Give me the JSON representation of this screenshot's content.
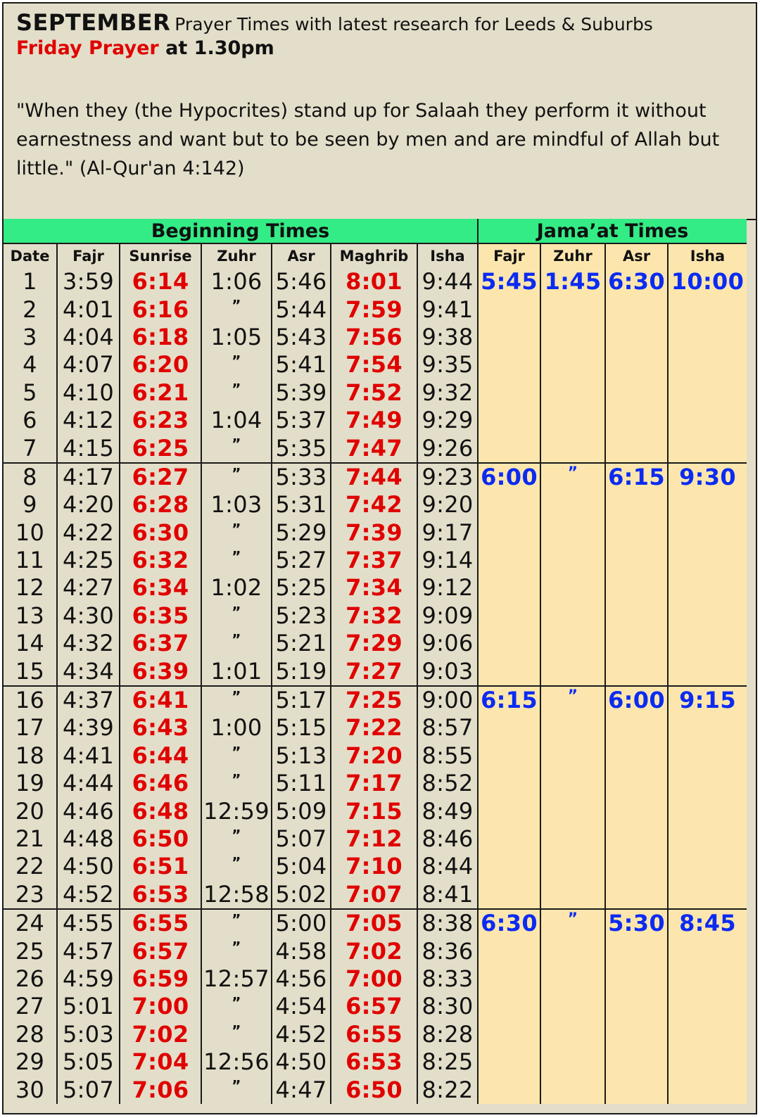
{
  "header": {
    "month": "SEPTEMBER",
    "subtitle": "Prayer Times with latest research for Leeds & Suburbs",
    "friday_label": "Friday Prayer",
    "friday_time": "at 1.30pm",
    "quote": "\"When they (the Hypocrites) stand up for Salaah they perform it without earnestness and want but to be seen by men and are mindful of Allah but little.\" (Al-Qur'an 4:142)"
  },
  "table": {
    "group_beginning": "Beginning Times",
    "group_jamaat": "Jama’at Times",
    "columns": [
      "Date",
      "Fajr",
      "Sunrise",
      "Zuhr",
      "Asr",
      "Maghrib",
      "Isha",
      "Fajr",
      "Zuhr",
      "Asr",
      "Isha"
    ],
    "ditto_mark": "”",
    "rows": [
      [
        "1",
        "3:59",
        "6:14",
        "1:06",
        "5:46",
        "8:01",
        "9:44"
      ],
      [
        "2",
        "4:01",
        "6:16",
        "”",
        "5:44",
        "7:59",
        "9:41"
      ],
      [
        "3",
        "4:04",
        "6:18",
        "1:05",
        "5:43",
        "7:56",
        "9:38"
      ],
      [
        "4",
        "4:07",
        "6:20",
        "”",
        "5:41",
        "7:54",
        "9:35"
      ],
      [
        "5",
        "4:10",
        "6:21",
        "”",
        "5:39",
        "7:52",
        "9:32"
      ],
      [
        "6",
        "4:12",
        "6:23",
        "1:04",
        "5:37",
        "7:49",
        "9:29"
      ],
      [
        "7",
        "4:15",
        "6:25",
        "”",
        "5:35",
        "7:47",
        "9:26"
      ],
      [
        "8",
        "4:17",
        "6:27",
        "”",
        "5:33",
        "7:44",
        "9:23"
      ],
      [
        "9",
        "4:20",
        "6:28",
        "1:03",
        "5:31",
        "7:42",
        "9:20"
      ],
      [
        "10",
        "4:22",
        "6:30",
        "”",
        "5:29",
        "7:39",
        "9:17"
      ],
      [
        "11",
        "4:25",
        "6:32",
        "”",
        "5:27",
        "7:37",
        "9:14"
      ],
      [
        "12",
        "4:27",
        "6:34",
        "1:02",
        "5:25",
        "7:34",
        "9:12"
      ],
      [
        "13",
        "4:30",
        "6:35",
        "”",
        "5:23",
        "7:32",
        "9:09"
      ],
      [
        "14",
        "4:32",
        "6:37",
        "”",
        "5:21",
        "7:29",
        "9:06"
      ],
      [
        "15",
        "4:34",
        "6:39",
        "1:01",
        "5:19",
        "7:27",
        "9:03"
      ],
      [
        "16",
        "4:37",
        "6:41",
        "”",
        "5:17",
        "7:25",
        "9:00"
      ],
      [
        "17",
        "4:39",
        "6:43",
        "1:00",
        "5:15",
        "7:22",
        "8:57"
      ],
      [
        "18",
        "4:41",
        "6:44",
        "”",
        "5:13",
        "7:20",
        "8:55"
      ],
      [
        "19",
        "4:44",
        "6:46",
        "”",
        "5:11",
        "7:17",
        "8:52"
      ],
      [
        "20",
        "4:46",
        "6:48",
        "12:59",
        "5:09",
        "7:15",
        "8:49"
      ],
      [
        "21",
        "4:48",
        "6:50",
        "”",
        "5:07",
        "7:12",
        "8:46"
      ],
      [
        "22",
        "4:50",
        "6:51",
        "”",
        "5:04",
        "7:10",
        "8:44"
      ],
      [
        "23",
        "4:52",
        "6:53",
        "12:58",
        "5:02",
        "7:07",
        "8:41"
      ],
      [
        "24",
        "4:55",
        "6:55",
        "”",
        "5:00",
        "7:05",
        "8:38"
      ],
      [
        "25",
        "4:57",
        "6:57",
        "”",
        "4:58",
        "7:02",
        "8:36"
      ],
      [
        "26",
        "4:59",
        "6:59",
        "12:57",
        "4:56",
        "7:00",
        "8:33"
      ],
      [
        "27",
        "5:01",
        "7:00",
        "”",
        "4:54",
        "6:57",
        "8:30"
      ],
      [
        "28",
        "5:03",
        "7:02",
        "”",
        "4:52",
        "6:55",
        "8:28"
      ],
      [
        "29",
        "5:05",
        "7:04",
        "12:56",
        "4:50",
        "6:53",
        "8:25"
      ],
      [
        "30",
        "5:07",
        "7:06",
        "”",
        "4:47",
        "6:50",
        "8:22"
      ]
    ],
    "jamaat_weeks": [
      {
        "start": 1,
        "end": 7,
        "fajr": "5:45",
        "zuhr": "1:45",
        "asr": "6:30",
        "isha": "10:00"
      },
      {
        "start": 8,
        "end": 15,
        "fajr": "6:00",
        "zuhr": "”",
        "asr": "6:15",
        "isha": "9:30"
      },
      {
        "start": 16,
        "end": 23,
        "fajr": "6:15",
        "zuhr": "”",
        "asr": "6:00",
        "isha": "9:15"
      },
      {
        "start": 24,
        "end": 30,
        "fajr": "6:30",
        "zuhr": "”",
        "asr": "5:30",
        "isha": "8:45"
      }
    ]
  },
  "colors": {
    "page_bg": "#e3dec9",
    "green_band": "#33ec85",
    "jamaat_bg": "#fde6ad",
    "red_text": "#e00000",
    "blue_text": "#0b2bf2"
  }
}
